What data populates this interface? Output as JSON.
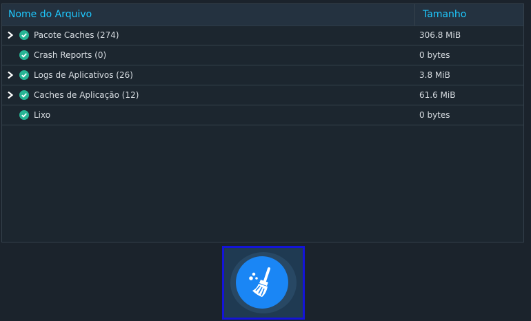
{
  "table": {
    "headers": {
      "name": "Nome do Arquivo",
      "size": "Tamanho"
    },
    "rows": [
      {
        "name": "Pacote Caches (274)",
        "size": "306.8 MiB",
        "expandable": true,
        "checked": true
      },
      {
        "name": "Crash Reports (0)",
        "size": "0 bytes",
        "expandable": false,
        "checked": true
      },
      {
        "name": "Logs de Aplicativos (26)",
        "size": "3.8 MiB",
        "expandable": true,
        "checked": true
      },
      {
        "name": "Caches de Aplicação (12)",
        "size": "61.6 MiB",
        "expandable": true,
        "checked": true
      },
      {
        "name": "Lixo",
        "size": "0 bytes",
        "expandable": false,
        "checked": true
      }
    ]
  },
  "icons": {
    "expand": "chevron-right-icon",
    "checked": "check-circle-icon",
    "clean": "broom-icon"
  },
  "colors": {
    "accent": "#1ec9ff",
    "check": "#27b495",
    "button": "#1a86f5"
  }
}
